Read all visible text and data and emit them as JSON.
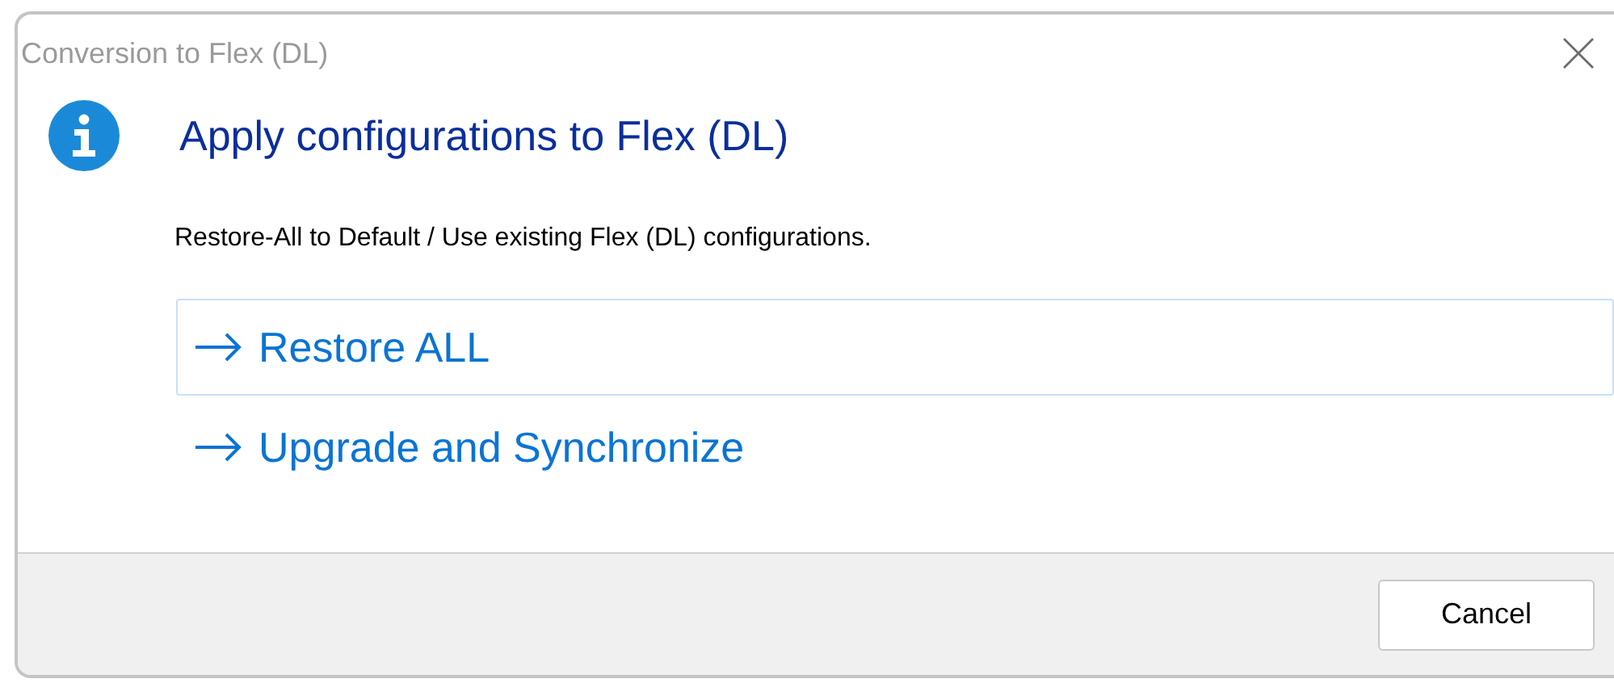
{
  "window": {
    "title": "Conversion to Flex (DL)"
  },
  "heading": "Apply configurations to Flex (DL)",
  "description": "Restore-All to Default / Use existing Flex (DL) configurations.",
  "commands": [
    {
      "label": "Restore ALL",
      "selected": true
    },
    {
      "label": "Upgrade and Synchronize",
      "selected": false
    }
  ],
  "buttons": [
    "Cancel"
  ]
}
